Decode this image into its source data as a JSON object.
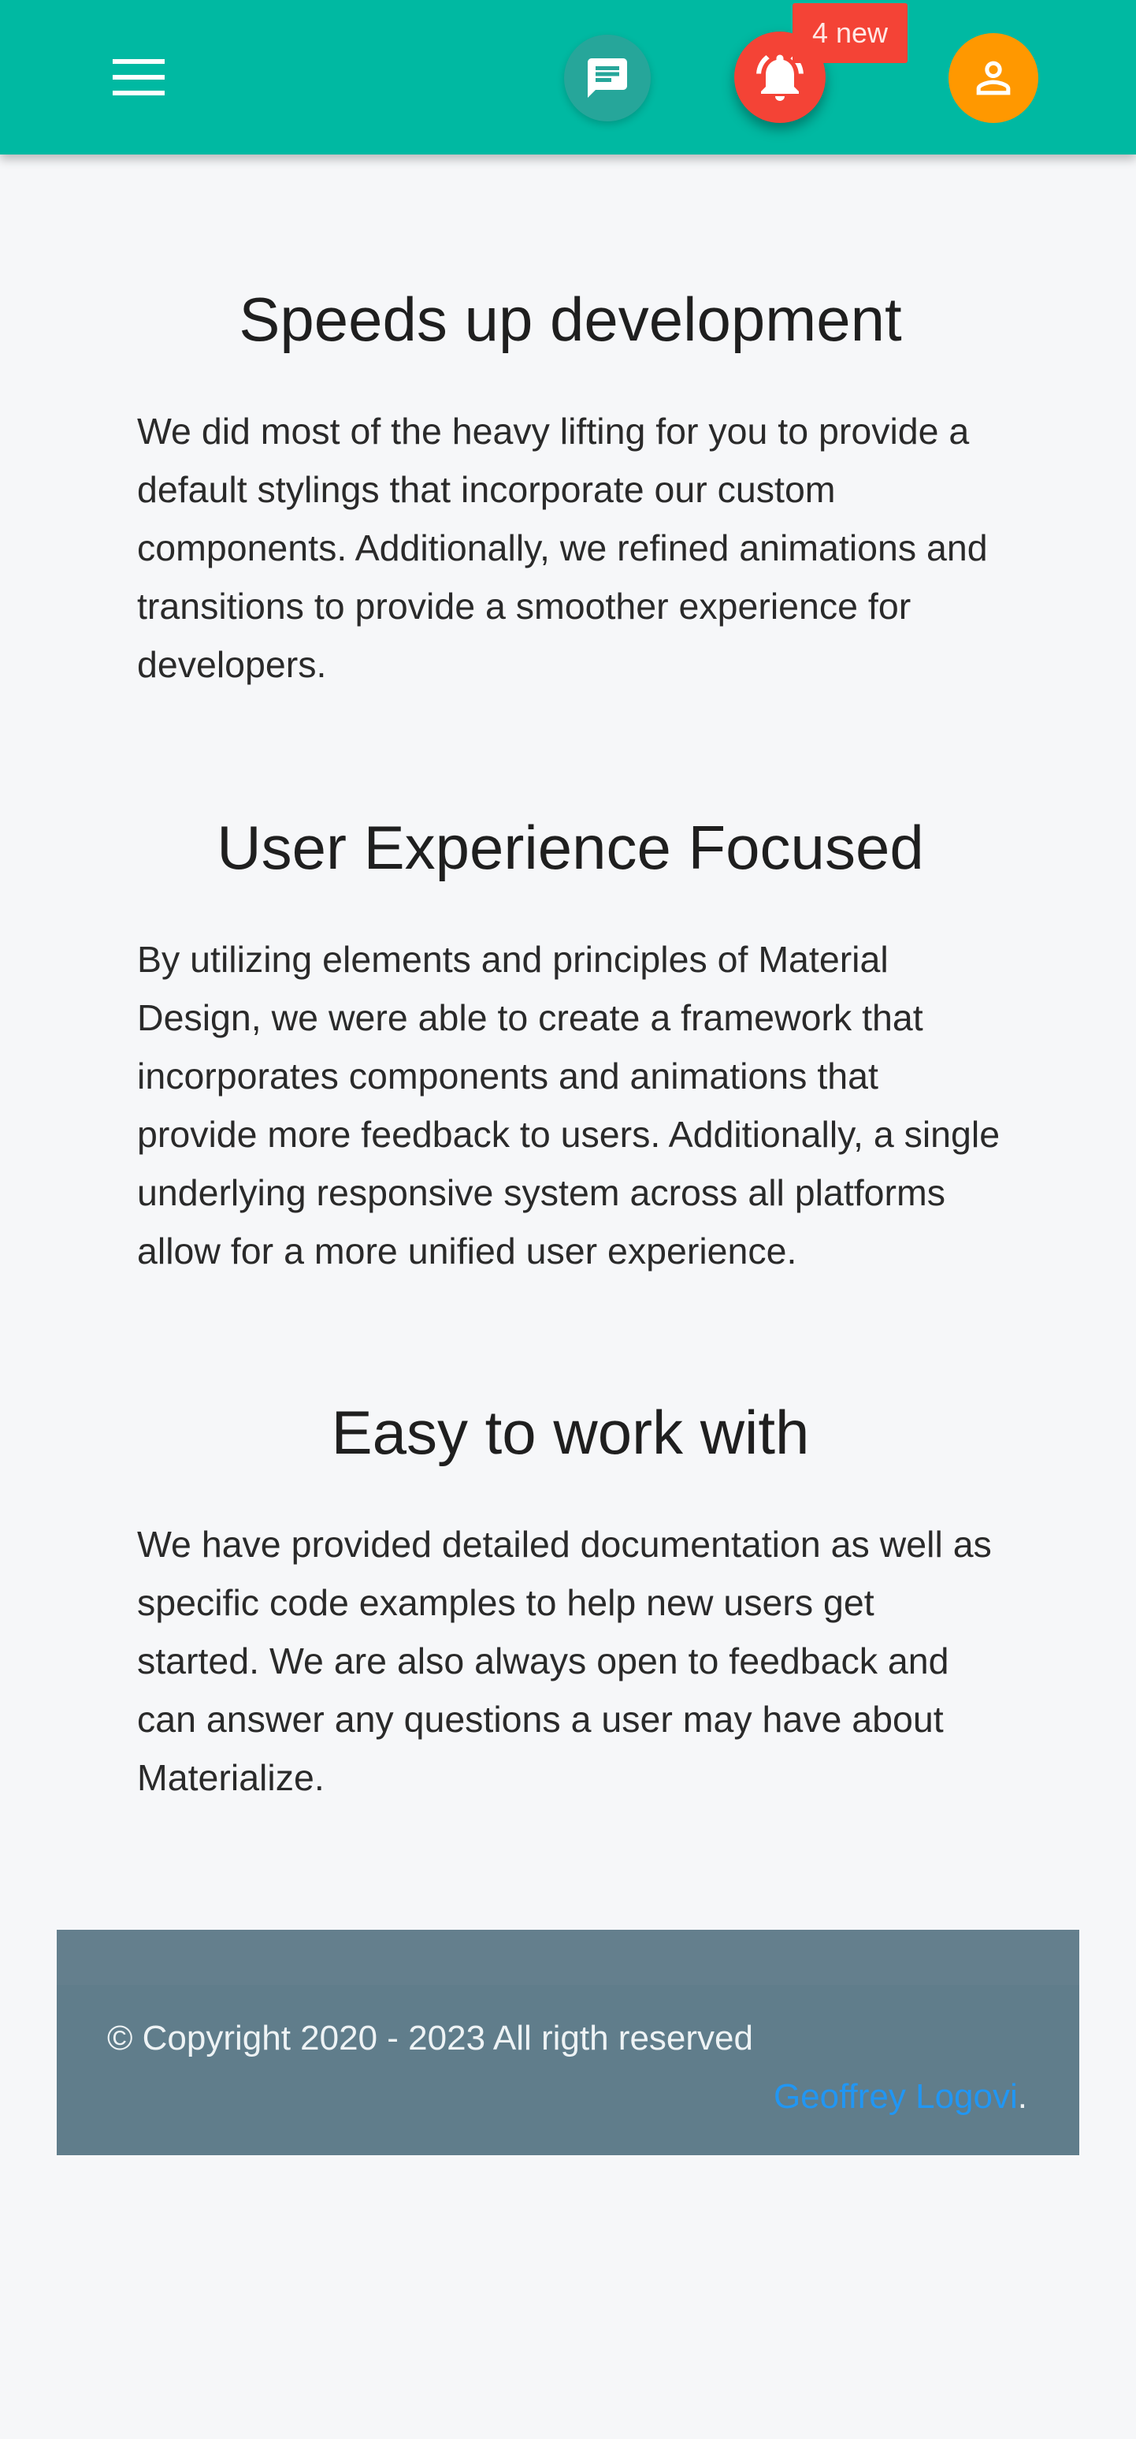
{
  "navbar": {
    "color": "#00b9a2",
    "menu_icon": "hamburger-menu-icon",
    "chat_icon": "chat-message-icon",
    "bell_icon": "bell-icon",
    "user_icon": "user-account-icon",
    "notification_badge": "4 new"
  },
  "sections": [
    {
      "title": "Speeds up development",
      "body": "We did most of the heavy lifting for you to provide a default stylings that incorporate our custom components. Additionally, we refined animations and transitions to provide a smoother experience for developers."
    },
    {
      "title": "User Experience Focused",
      "body": "By utilizing elements and principles of Material Design, we were able to create a framework that incorporates components and animations that provide more feedback to users. Additionally, a single underlying responsive system across all platforms allow for a more unified user experience."
    },
    {
      "title": "Easy to work with",
      "body": "We have provided detailed documentation as well as specific code examples to help new users get started. We are also always open to feedback and can answer any questions a user may have about Materialize."
    }
  ],
  "footer": {
    "copyright": "© Copyright 2020 - 2023 All rigth reserved",
    "author_name": "Geoffrey Logovi",
    "author_suffix": ".",
    "background": "#607d8b",
    "link_color": "#2196f3"
  }
}
